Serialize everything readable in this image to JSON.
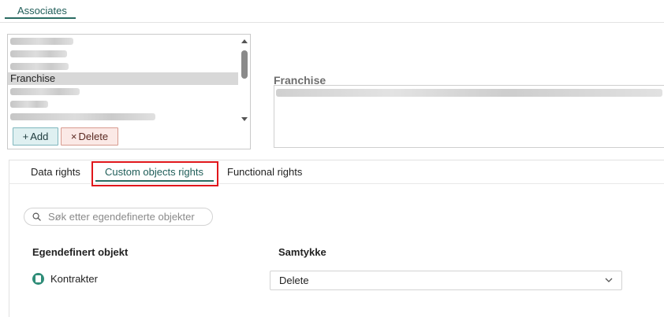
{
  "header": {
    "tab_label": "Associates"
  },
  "roles": {
    "selected_label": "Franchise",
    "add_label": "Add",
    "delete_label": "Delete"
  },
  "detail": {
    "title": "Franchise"
  },
  "tabs": [
    {
      "label": "Data rights"
    },
    {
      "label": "Custom objects rights"
    },
    {
      "label": "Functional rights"
    }
  ],
  "search": {
    "placeholder": "Søk etter egendefinerte objekter"
  },
  "table": {
    "col_object": "Egendefinert objekt",
    "col_consent": "Samtykke",
    "rows": [
      {
        "object": "Kontrakter",
        "consent": "Delete",
        "icon": "document-icon"
      }
    ]
  },
  "colors": {
    "accent": "#2a6b62",
    "highlight": "#e0161b",
    "add_bg": "#dff0f1",
    "delete_bg": "#fbe9e6",
    "object_icon": "#2f8d78"
  }
}
